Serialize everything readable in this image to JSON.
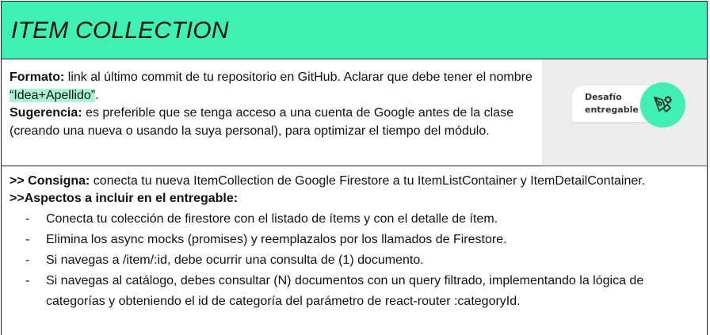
{
  "header": {
    "title": "ITEM COLLECTION"
  },
  "info": {
    "formato_label": "Formato:",
    "formato_text_1": " link al último commit de tu repositorio en GitHub. Aclarar que debe tener el nombre ",
    "formato_highlight": "“Idea+Apellido”",
    "formato_text_2": ".",
    "sugerencia_label": "Sugerencia:",
    "sugerencia_text": " es preferible que se tenga acceso a una cuenta de Google antes de la clase (creando una nueva o usando la suya personal), para optimizar el tiempo del módulo."
  },
  "badge": {
    "line1": "Desafío",
    "line2": "entregable",
    "icon": "pen-gear-icon",
    "accent": "#3ef1b2"
  },
  "consigna": {
    "label": ">> Consigna:",
    "text": " conecta tu nueva ItemCollection de Google Firestore a tu ItemListContainer y ItemDetailContainer.",
    "aspectos_label": ">>Aspectos a incluir en el entregable:",
    "items": [
      "Conecta tu colección de firestore con el listado de ítems y con el detalle de ítem.",
      "Elimina los async mocks (promises) y reemplazalos por los llamados de Firestore.",
      "Si navegas a /item/:id, debe ocurrir una consulta de (1) documento.",
      "Si navegas al catálogo, debes consultar (N) documentos con un query filtrado, implementando la lógica de categorías y obteniendo el id de categoría del parámetro de react-router :categoryId."
    ]
  }
}
